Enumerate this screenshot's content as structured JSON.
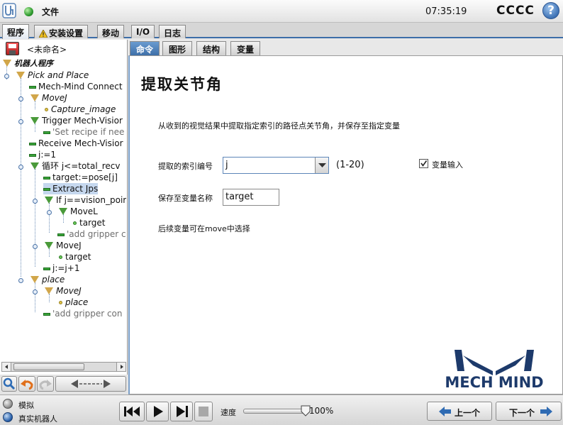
{
  "header": {
    "logo_icon": "ur-logo-icon",
    "status_icon": "green-status-icon",
    "file_menu": "文件",
    "time": "07:35:19",
    "robot_name": "CCCC",
    "help_icon": "help-icon"
  },
  "main_tabs": [
    {
      "label": "程序"
    },
    {
      "label": "安装设置"
    },
    {
      "label": "移动"
    },
    {
      "label": "I/O"
    },
    {
      "label": "日志"
    }
  ],
  "program": {
    "name": "<未命名>"
  },
  "tree": {
    "root": "机器人程序",
    "n1": "Pick and Place",
    "n2": "Mech-Mind Connect",
    "n3": "MoveJ",
    "n4": "Capture_image",
    "n5": "Trigger Mech-Visior",
    "n6": "'Set recipe if nee",
    "n7": "Receive Mech-Visior",
    "n8": "j:=1",
    "n9": "循环 j<=total_recv",
    "n10": "target:=pose[j]",
    "n11": "Extract Jps",
    "n12": "If j==vision_poir",
    "n13": "MoveL",
    "n14": "target",
    "n15": "'add gripper c",
    "n16": "MoveJ",
    "n17": "target",
    "n18": "j:=j+1",
    "n19": "place",
    "n20": "MoveJ",
    "n21": "place",
    "n22": "'add gripper con"
  },
  "sub_tabs": [
    {
      "label": "命令"
    },
    {
      "label": "图形"
    },
    {
      "label": "结构"
    },
    {
      "label": "变量"
    }
  ],
  "command": {
    "title": "提取关节角",
    "description": "从收到的视觉结果中提取指定索引的路径点关节角，并保存至指定变量",
    "index_label": "提取的索引编号",
    "index_value": "j",
    "index_range": "(1-20)",
    "var_input_label": "变量输入",
    "var_input_checked": true,
    "save_label": "保存至变量名称",
    "save_value": "target",
    "note": "后续变量可在move中选择"
  },
  "brand": {
    "name": "MECH MIND",
    "color": "#1d3a6b"
  },
  "footer": {
    "sim_label": "模拟",
    "real_label": "真实机器人",
    "speed_label": "速度",
    "speed_value": "100%",
    "prev": "上一个",
    "next": "下一个"
  }
}
